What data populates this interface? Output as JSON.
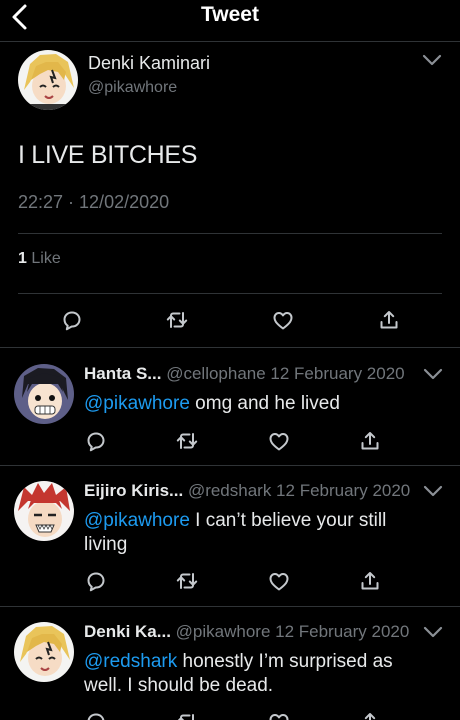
{
  "header": {
    "title": "Tweet"
  },
  "tweet": {
    "author_name": "Denki Kaminari",
    "author_handle": "@pikawhore",
    "text": "I LIVE BITCHES",
    "timestamp": "22:27 · 12/02/2020",
    "like_count": "1",
    "like_label": "Like"
  },
  "replies": [
    {
      "name": "Hanta S...",
      "meta": "@cellophane 12 February 2020",
      "mention": "@pikawhore",
      "text": " omg and he lived"
    },
    {
      "name": "Eijiro Kiris...",
      "meta": "@redshark 12 February 2020",
      "mention": "@pikawhore",
      "text": " I can’t believe your still living"
    },
    {
      "name": "Denki Ka...",
      "meta": "@pikawhore 12 February 2020",
      "mention": "@redshark",
      "text": " honestly I’m surprised as well. I should be dead."
    }
  ],
  "icons": {
    "back": "chevron-left-icon",
    "more": "chevron-down-icon",
    "reply": "comment-icon",
    "retweet": "retweet-icon",
    "like": "heart-icon",
    "share": "share-icon"
  },
  "colors": {
    "background": "#000000",
    "text": "#e7e9ea",
    "secondary": "#71767b",
    "accent": "#1d9bf0",
    "divider": "#2f3336"
  }
}
